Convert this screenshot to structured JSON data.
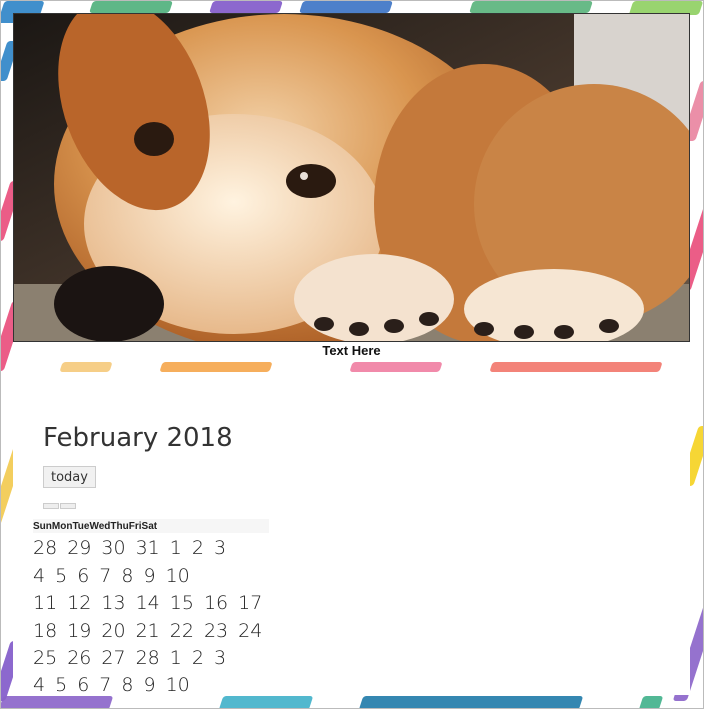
{
  "photo": {
    "subject": "dog-photo",
    "caption": "Text Here"
  },
  "calendar": {
    "month_title": "February 2018",
    "today_label": "today",
    "weekdays": [
      "Sun",
      "Mon",
      "Tue",
      "Wed",
      "Thu",
      "Fri",
      "Sat"
    ],
    "weeks": [
      [
        "28",
        "29",
        "30",
        "31",
        "1",
        "2",
        "3"
      ],
      [
        "4",
        "5",
        "6",
        "7",
        "8",
        "9",
        "10"
      ],
      [
        "11",
        "12",
        "13",
        "14",
        "15",
        "16",
        "17"
      ],
      [
        "18",
        "19",
        "20",
        "21",
        "22",
        "23",
        "24"
      ],
      [
        "25",
        "26",
        "27",
        "28",
        "1",
        "2",
        "3"
      ],
      [
        "4",
        "5",
        "6",
        "7",
        "8",
        "9",
        "10"
      ]
    ]
  },
  "colors": {
    "accent_yellow": "#f2c94c",
    "accent_pink": "#e94b7a",
    "accent_blue": "#2f7fc1",
    "accent_green": "#4caf7a",
    "accent_orange": "#f59a3b"
  }
}
